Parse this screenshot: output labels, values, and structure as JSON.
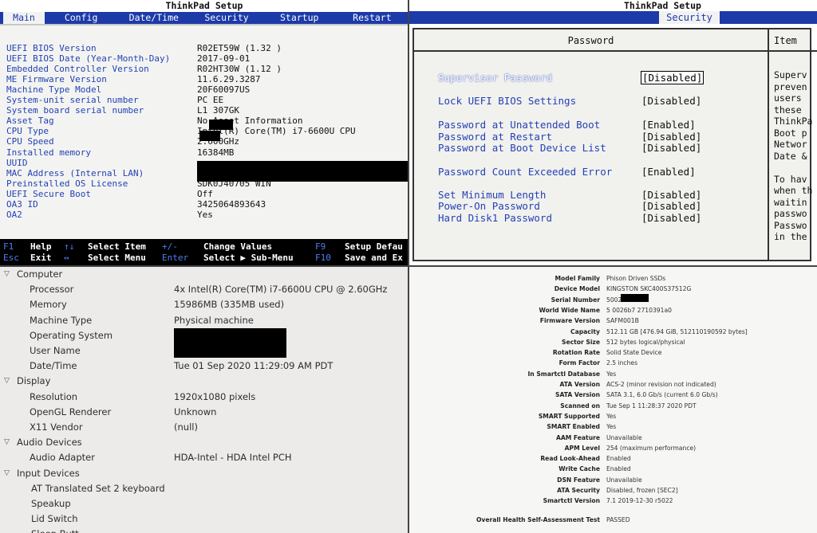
{
  "bios_main": {
    "title": "ThinkPad Setup",
    "tabs": [
      "Main",
      "Config",
      "Date/Time",
      "Security",
      "Startup",
      "Restart"
    ],
    "active_tab": "Main",
    "rows": [
      {
        "label": "UEFI BIOS Version",
        "value": "R02ET59W (1.32 )"
      },
      {
        "label": "UEFI BIOS Date (Year-Month-Day)",
        "value": "2017-09-01"
      },
      {
        "label": "Embedded Controller Version",
        "value": "R02HT30W (1.12 )"
      },
      {
        "label": "ME Firmware Version",
        "value": "11.6.29.3287"
      },
      {
        "label": "Machine Type Model",
        "value": "20F60097US"
      },
      {
        "label": "System-unit serial number",
        "value": "PC      EE"
      },
      {
        "label": "System board serial number",
        "value": "L1       307GK"
      },
      {
        "label": "Asset Tag",
        "value": "No Asset Information"
      },
      {
        "label": "CPU Type",
        "value": "Intel(R) Core(TM) i7-6600U CPU"
      },
      {
        "label": "CPU Speed",
        "value": "2.600GHz"
      },
      {
        "label": "Installed memory",
        "value": "16384MB"
      },
      {
        "label": "UUID",
        "value": ""
      },
      {
        "label": "MAC Address (Internal LAN)",
        "value": ""
      },
      {
        "label": "Preinstalled OS License",
        "value": "SDK0J40705 WIN"
      },
      {
        "label": "UEFI Secure Boot",
        "value": "Off"
      },
      {
        "label": "OA3 ID",
        "value": "3425064893643"
      },
      {
        "label": "OA2",
        "value": "Yes"
      }
    ],
    "footer": {
      "row1": {
        "k1": "F1",
        "d1": "Help",
        "k2": "↑↓",
        "d2": "Select Item",
        "k3": "+/-",
        "d3": "Change Values",
        "k4": "F9",
        "d4": "Setup Defau"
      },
      "row2": {
        "k1": "Esc",
        "d1": "Exit",
        "k2": "↔",
        "d2": "Select Menu",
        "k3": "Enter",
        "d3": "Select ▶ Sub-Menu",
        "k4": "F10",
        "d4": "Save and Ex"
      }
    }
  },
  "bios_security": {
    "title": "ThinkPad Setup",
    "active_tab": "Security",
    "panel_title": "Password",
    "help_title": "Item",
    "rows": [
      {
        "label": "Supervisor Password",
        "value": "[Disabled]",
        "selected": true
      },
      {
        "label": "Lock UEFI BIOS Settings",
        "value": "[Disabled]"
      },
      {
        "label": "Password at Unattended Boot",
        "value": "[Enabled]"
      },
      {
        "label": "Password at Restart",
        "value": "[Disabled]"
      },
      {
        "label": "Password at Boot Device List",
        "value": "[Disabled]"
      },
      {
        "label": "Password Count Exceeded Error",
        "value": "[Enabled]"
      },
      {
        "label": "Set Minimum Length",
        "value": "[Disabled]"
      },
      {
        "label": "Power-On Password",
        "value": "[Disabled]"
      },
      {
        "label": "Hard Disk1 Password",
        "value": "[Disabled]"
      }
    ],
    "help_lines": [
      "Superv",
      "preven",
      "users",
      "these",
      "ThinkPa",
      "Boot p",
      "Networ",
      "Date &",
      "",
      "To hav",
      "when th",
      "waitin",
      "passwo",
      "Passwo",
      "in the"
    ]
  },
  "system_info": {
    "rows": [
      {
        "type": "group",
        "label": "Computer"
      },
      {
        "type": "item",
        "label": "Processor",
        "value": "4x Intel(R) Core(TM) i7-6600U CPU @ 2.60GHz"
      },
      {
        "type": "item",
        "label": "Memory",
        "value": "15986MB (335MB used)"
      },
      {
        "type": "item",
        "label": "Machine Type",
        "value": "Physical machine"
      },
      {
        "type": "item",
        "label": "Operating System",
        "value": ""
      },
      {
        "type": "item",
        "label": "User Name",
        "value": ""
      },
      {
        "type": "item",
        "label": "Date/Time",
        "value": "Tue 01 Sep 2020 11:29:09 AM PDT"
      },
      {
        "type": "group",
        "label": "Display"
      },
      {
        "type": "item",
        "label": "Resolution",
        "value": "1920x1080 pixels"
      },
      {
        "type": "item",
        "label": "OpenGL Renderer",
        "value": "Unknown"
      },
      {
        "type": "item",
        "label": "X11 Vendor",
        "value": "(null)"
      },
      {
        "type": "group",
        "label": "Audio Devices"
      },
      {
        "type": "item",
        "label": "Audio Adapter",
        "value": "HDA-Intel - HDA Intel PCH"
      },
      {
        "type": "group",
        "label": "Input Devices"
      },
      {
        "type": "sub",
        "label": "AT Translated Set 2 keyboard",
        "value": ""
      },
      {
        "type": "sub",
        "label": "Speakup",
        "value": ""
      },
      {
        "type": "sub",
        "label": "Lid Switch",
        "value": ""
      },
      {
        "type": "sub",
        "label": "Sleep Butt",
        "value": ""
      }
    ]
  },
  "smart_info": {
    "rows": [
      {
        "label": "Model Family",
        "value": "Phison Driven SSDs"
      },
      {
        "label": "Device Model",
        "value": "KINGSTON SKC400S37512G"
      },
      {
        "label": "Serial Number",
        "value": "5002          91A0"
      },
      {
        "label": "World Wide Name",
        "value": "5 0026b7 2710391a0"
      },
      {
        "label": "Firmware Version",
        "value": "SAFM001B"
      },
      {
        "label": "Capacity",
        "value": "512.11 GB [476.94 GiB, 512110190592 bytes]"
      },
      {
        "label": "Sector Size",
        "value": "512 bytes logical/physical"
      },
      {
        "label": "Rotation Rate",
        "value": "Solid State Device"
      },
      {
        "label": "Form Factor",
        "value": "2.5 inches"
      },
      {
        "label": "In Smartctl Database",
        "value": "Yes"
      },
      {
        "label": "ATA Version",
        "value": "ACS-2 (minor revision not indicated)"
      },
      {
        "label": "SATA Version",
        "value": "SATA 3.1, 6.0 Gb/s (current 6.0 Gb/s)"
      },
      {
        "label": "Scanned on",
        "value": "Tue Sep  1 11:28:37 2020 PDT"
      },
      {
        "label": "SMART Supported",
        "value": "Yes"
      },
      {
        "label": "SMART Enabled",
        "value": "Yes"
      },
      {
        "label": "AAM Feature",
        "value": "Unavailable"
      },
      {
        "label": "APM Level",
        "value": "254 (maximum performance)"
      },
      {
        "label": "Read Look-Ahead",
        "value": "Enabled"
      },
      {
        "label": "Write Cache",
        "value": "Enabled"
      },
      {
        "label": "DSN Feature",
        "value": "Unavailable"
      },
      {
        "label": "ATA Security",
        "value": "Disabled, frozen [SEC2]"
      },
      {
        "label": "Smartctl Version",
        "value": "7.1 2019-12-30 r5022"
      }
    ],
    "overall": {
      "label": "Overall Health Self-Assessment Test",
      "value": "PASSED"
    }
  },
  "colors": {
    "bios_blue": "#1c3aa8",
    "bios_label": "#2441b5",
    "bios_key": "#4d7cf3",
    "redaction": "#000000"
  }
}
